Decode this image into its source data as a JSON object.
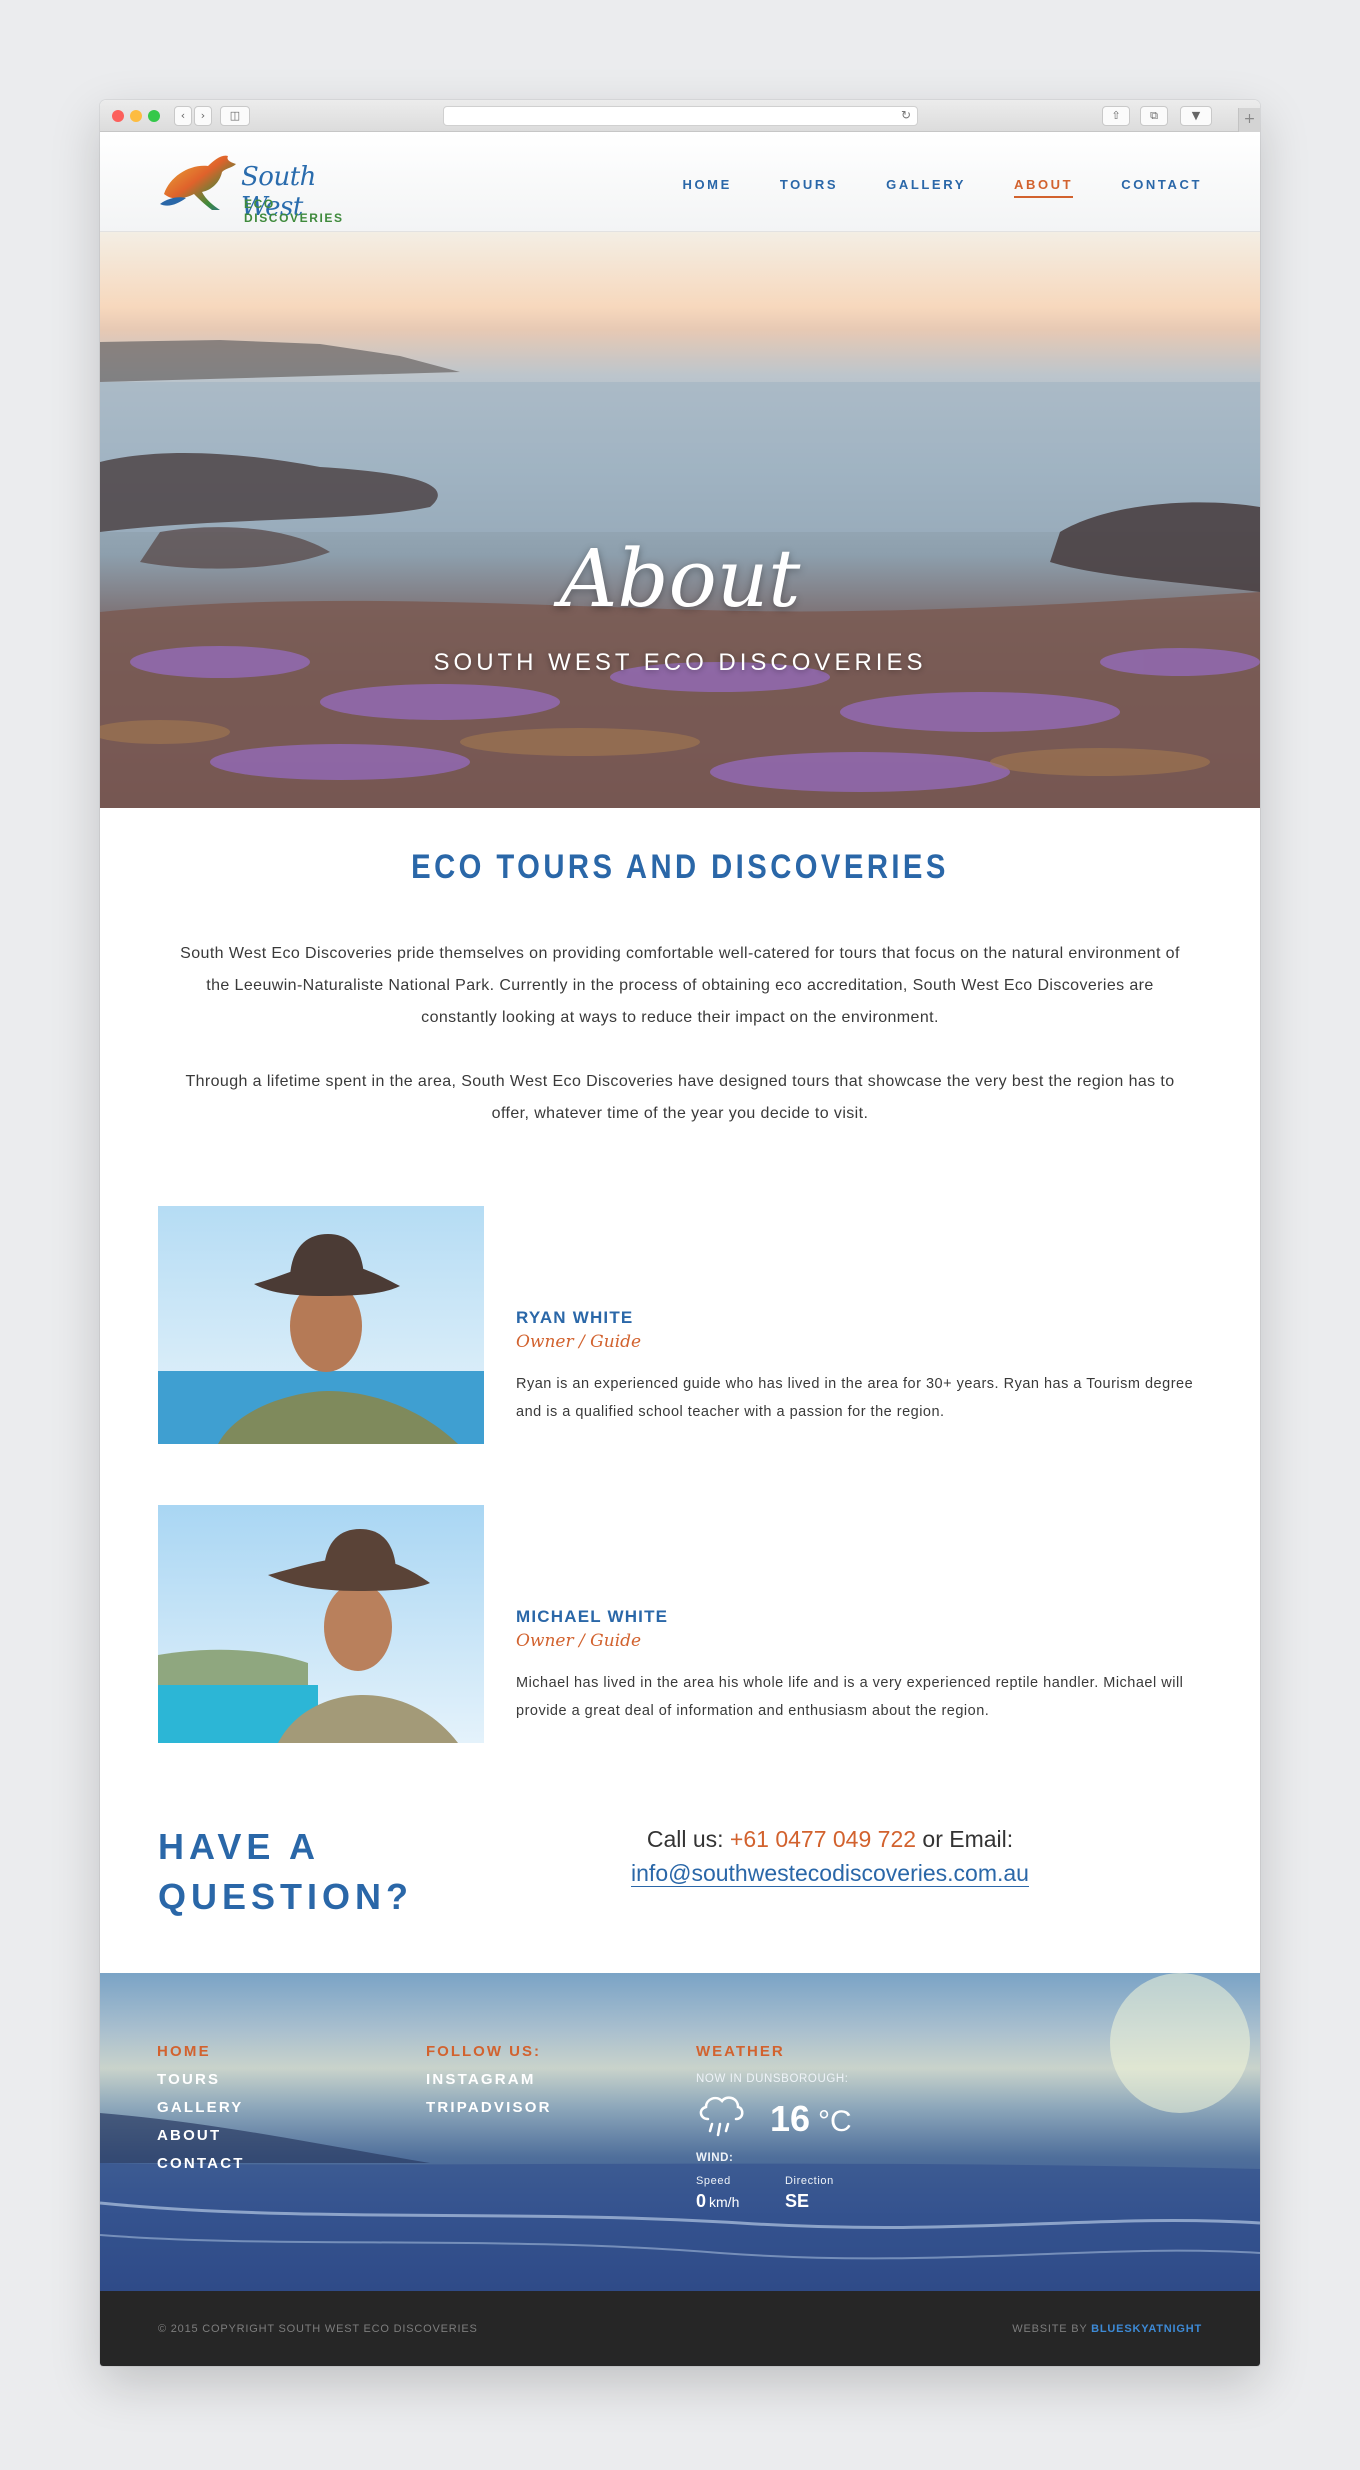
{
  "colors": {
    "brand_blue": "#2a67a8",
    "accent_orange": "#d2622e",
    "footer_dark": "#262626",
    "link_blue": "#3d8ad6"
  },
  "browser": {
    "icons": [
      "back-icon",
      "forward-icon",
      "sidebar-icon",
      "reload-icon",
      "share-icon",
      "tabs-icon",
      "download-icon",
      "new-tab-icon"
    ]
  },
  "logo": {
    "script": "South West",
    "sub": "ECO DISCOVERIES"
  },
  "nav": {
    "items": [
      {
        "label": "HOME"
      },
      {
        "label": "TOURS"
      },
      {
        "label": "GALLERY"
      },
      {
        "label": "ABOUT",
        "active": true
      },
      {
        "label": "CONTACT"
      }
    ]
  },
  "hero": {
    "title": "About",
    "subtitle": "SOUTH WEST ECO DISCOVERIES"
  },
  "intro": {
    "title": "ECO TOURS AND DISCOVERIES",
    "p1": "South West Eco Discoveries pride themselves on providing comfortable well-catered for tours that focus on the natural environment of the Leeuwin-Naturaliste National Park. Currently in the process of obtaining eco accreditation, South West Eco Discoveries are constantly looking at ways to reduce their impact on the environment.",
    "p2": "Through a lifetime spent in the area, South West Eco Discoveries have designed tours that showcase the very best the region has to offer, whatever time of the year you decide to visit."
  },
  "team": [
    {
      "name": "RYAN WHITE",
      "role": "Owner / Guide",
      "bio": "Ryan is an experienced guide who has lived in the area for 30+ years. Ryan has a Tourism degree and is a qualified school teacher with a passion for the region."
    },
    {
      "name": "MICHAEL WHITE",
      "role": "Owner / Guide",
      "bio": "Michael has lived in the area his whole life and is a very experienced reptile handler. Michael will provide a great deal of information and enthusiasm about the region."
    }
  ],
  "question": {
    "line1": "HAVE A",
    "line2": "QUESTION?",
    "call_label": "Call us:",
    "phone": "+61 0477 049 722",
    "or_email": "or Email:",
    "email": "info@southwestecodiscoveries.com.au"
  },
  "footer": {
    "nav": [
      {
        "label": "HOME",
        "active": true
      },
      {
        "label": "TOURS"
      },
      {
        "label": "GALLERY"
      },
      {
        "label": "ABOUT"
      },
      {
        "label": "CONTACT"
      }
    ],
    "follow_title": "FOLLOW US:",
    "social": [
      "INSTAGRAM",
      "TRIPADVISOR"
    ],
    "weather": {
      "title": "WEATHER",
      "location": "NOW IN DUNSBOROUGH:",
      "icon": "rain-cloud-icon",
      "temp": "16",
      "temp_unit": "°C",
      "wind_label": "WIND:",
      "speed_label": "Speed",
      "speed_value": "0",
      "speed_unit": "km/h",
      "direction_label": "Direction",
      "direction_value": "SE"
    }
  },
  "bottom": {
    "copyright": "© 2015 COPYRIGHT SOUTH WEST ECO DISCOVERIES",
    "website_by": "WEBSITE BY",
    "agency": "BLUESKYATNIGHT"
  }
}
